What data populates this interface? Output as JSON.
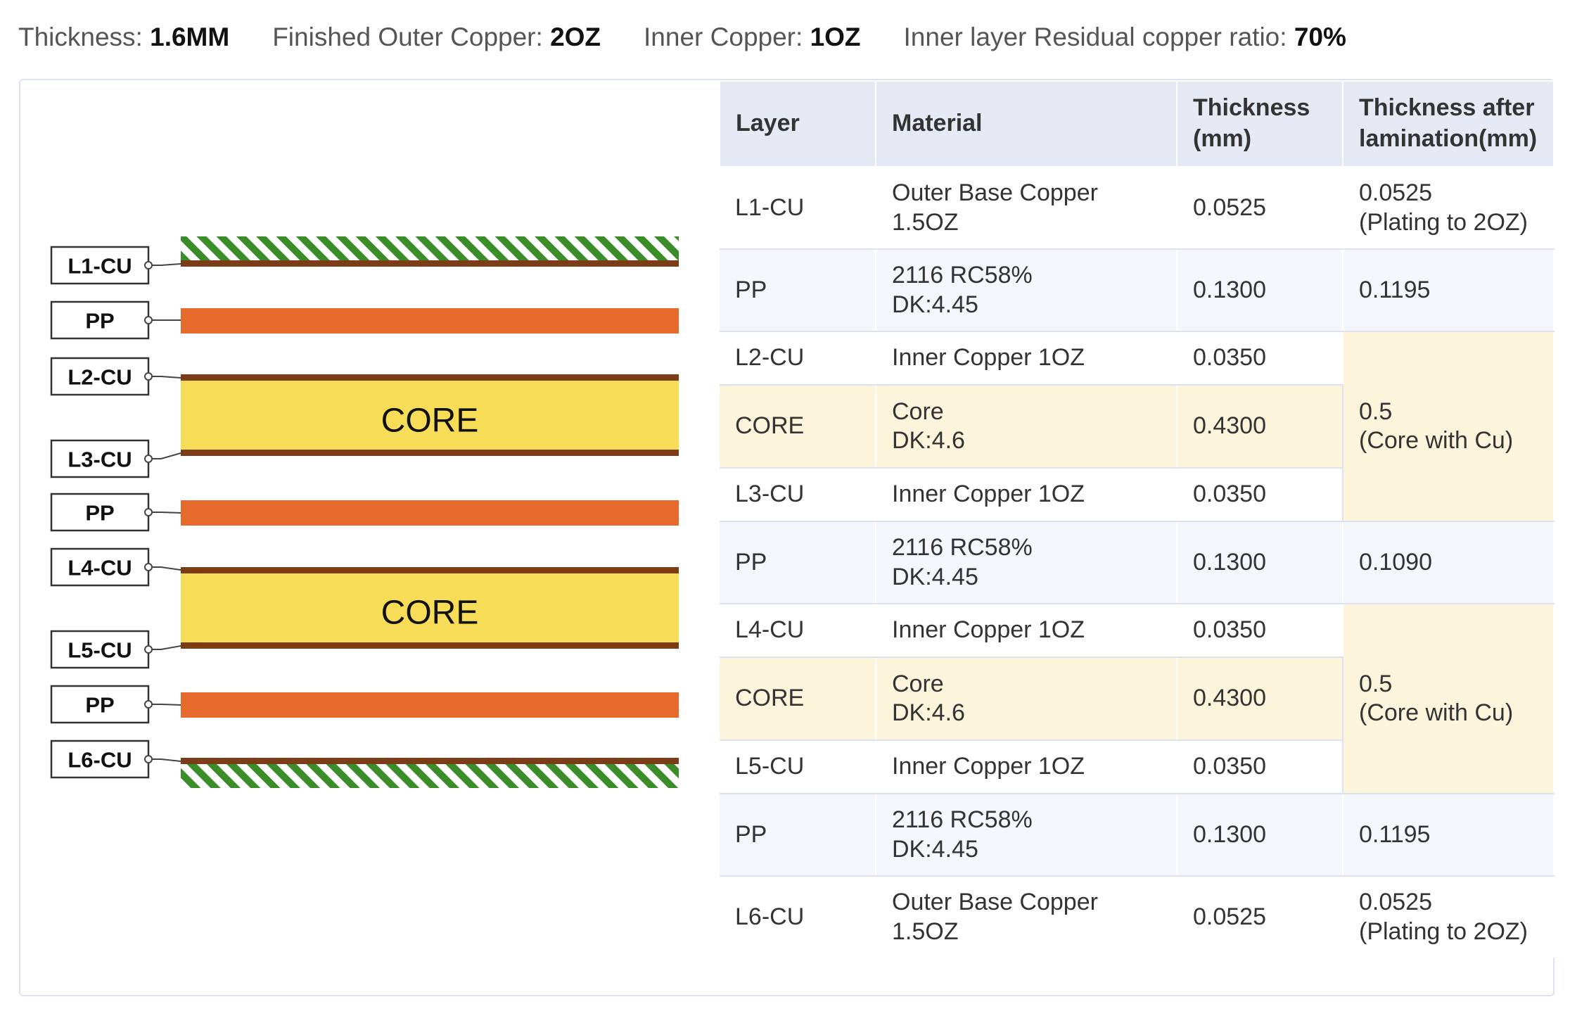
{
  "specs": [
    {
      "label": "Thickness: ",
      "value": "1.6MM"
    },
    {
      "label": "Finished Outer Copper: ",
      "value": "2OZ"
    },
    {
      "label": "Inner Copper: ",
      "value": "1OZ"
    },
    {
      "label": "Inner layer Residual copper ratio: ",
      "value": "70%"
    }
  ],
  "diagram": {
    "layer_labels": [
      "L1-CU",
      "PP",
      "L2-CU",
      "L3-CU",
      "PP",
      "L4-CU",
      "L5-CU",
      "PP",
      "L6-CU"
    ],
    "core_label": "CORE",
    "colors": {
      "copper": "#7a3d17",
      "prepreg": "#e56a2c",
      "core": "#f7dd57",
      "soldermask": "#3b8d2a",
      "label_border": "#333333"
    }
  },
  "table": {
    "headers": {
      "layer": "Layer",
      "material": "Material",
      "thickness": [
        "Thickness",
        "(mm)"
      ],
      "after": [
        "Thickness after",
        "lamination(mm)"
      ]
    },
    "rows": [
      {
        "layer": "L1-CU",
        "material": [
          "Outer Base Copper",
          "1.5OZ"
        ],
        "thickness": "0.0525",
        "after": [
          "0.0525",
          "(Plating to 2OZ)"
        ]
      },
      {
        "layer": "PP",
        "material": [
          "2116 RC58%",
          "DK:4.45"
        ],
        "thickness": "0.1300",
        "after": [
          "0.1195"
        ]
      },
      {
        "layer": "L2-CU",
        "material": [
          "Inner Copper 1OZ"
        ],
        "thickness": "0.0350",
        "after": [
          "0.5",
          "(Core with Cu)"
        ]
      },
      {
        "layer": "CORE",
        "material": [
          "Core",
          "DK:4.6"
        ],
        "thickness": "0.4300"
      },
      {
        "layer": "L3-CU",
        "material": [
          "Inner Copper 1OZ"
        ],
        "thickness": "0.0350"
      },
      {
        "layer": "PP",
        "material": [
          "2116 RC58%",
          "DK:4.45"
        ],
        "thickness": "0.1300",
        "after": [
          "0.1090"
        ]
      },
      {
        "layer": "L4-CU",
        "material": [
          "Inner Copper 1OZ"
        ],
        "thickness": "0.0350",
        "after": [
          "0.5",
          "(Core with Cu)"
        ]
      },
      {
        "layer": "CORE",
        "material": [
          "Core",
          "DK:4.6"
        ],
        "thickness": "0.4300"
      },
      {
        "layer": "L5-CU",
        "material": [
          "Inner Copper 1OZ"
        ],
        "thickness": "0.0350"
      },
      {
        "layer": "PP",
        "material": [
          "2116 RC58%",
          "DK:4.45"
        ],
        "thickness": "0.1300",
        "after": [
          "0.1195"
        ]
      },
      {
        "layer": "L6-CU",
        "material": [
          "Outer Base Copper",
          "1.5OZ"
        ],
        "thickness": "0.0525",
        "after": [
          "0.0525",
          "(Plating to 2OZ)"
        ]
      }
    ]
  }
}
